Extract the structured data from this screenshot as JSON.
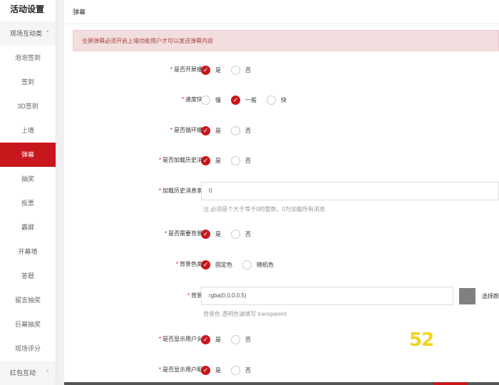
{
  "sidebar": {
    "title": "活动设置",
    "group1": "现场互动类",
    "items": [
      "泡泡签到",
      "签到",
      "3D签到",
      "上墙",
      "弹幕",
      "抽奖",
      "投票",
      "霸屏",
      "开幕墙",
      "答题",
      "留言抽奖",
      "巨幕抽奖",
      "现场评分"
    ],
    "active": "弹幕",
    "group2": "红包互动"
  },
  "panel": {
    "title": "弹幕",
    "alert": "全屏弹幕必须开启上墙功能用户才可以发送弹幕内容"
  },
  "form": {
    "fullscreen": {
      "label": "是否开屏播放",
      "yes": "是",
      "no": "否",
      "value": "是"
    },
    "speed": {
      "label": "速度快慢",
      "slow": "慢",
      "normal": "一般",
      "fast": "快",
      "value": "一般"
    },
    "loop": {
      "label": "是否循环播放",
      "yes": "是",
      "no": "否",
      "value": "是"
    },
    "history": {
      "label": "是否加载历史消息",
      "yes": "是",
      "no": "否",
      "value": "是"
    },
    "history_count": {
      "label": "加载历史消息条数",
      "value": "0",
      "help": "注:必须是个大于等于0的整数，0为加载所有消息"
    },
    "need_bg": {
      "label": "是否需要背景色",
      "yes": "是",
      "no": "否",
      "value": "是"
    },
    "bg_type": {
      "label": "背景色类型",
      "fixed": "固定色",
      "random": "随机色",
      "value": "固定色"
    },
    "bg_color": {
      "label": "背景色",
      "value": "rgba(0,0,0,0.5)",
      "pick": "选择颜",
      "help": "背景色 透明色请填写 transparent",
      "swatch": "#808080"
    },
    "show_avatar": {
      "label": "是否显示用户头像",
      "yes": "是",
      "no": "否",
      "value": "是"
    },
    "show_nick": {
      "label": "是否显示用户昵称",
      "yes": "是",
      "no": "否",
      "value": "是"
    }
  },
  "watermark": "52",
  "colors": {
    "accent": "#c8161d",
    "alert_bg": "#f2dede",
    "alert_text": "#a94442"
  }
}
